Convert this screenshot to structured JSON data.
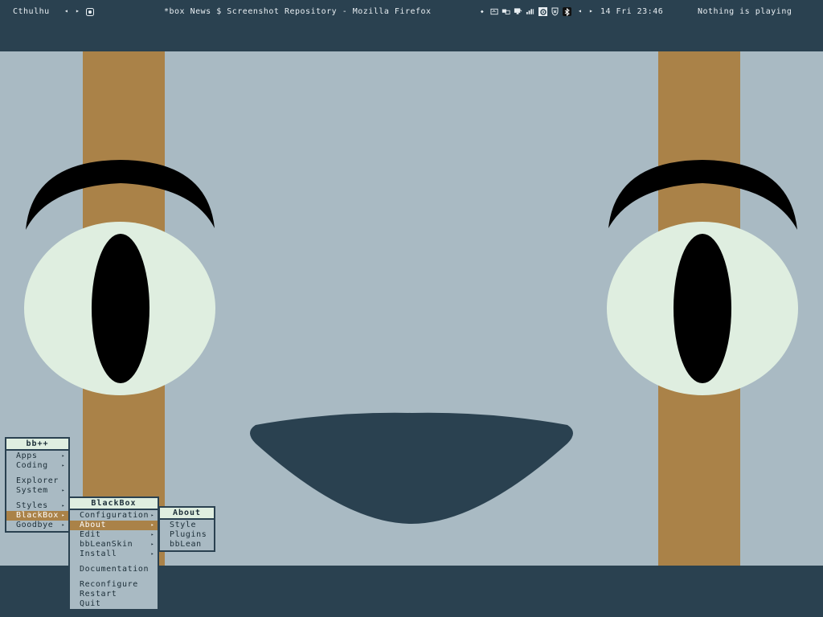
{
  "topbar": {
    "workspace": "Cthulhu",
    "window_title": "*box News $ Screenshot Repository - Mozilla Firefox",
    "clock": "14 Fri 23:46",
    "media": "Nothing is playing",
    "prev_glyph": "◂",
    "next_glyph": "▸",
    "bullet_glyph": "◆",
    "tray_icons": [
      "window-icon",
      "network-icon",
      "monitor-icon",
      "volume-icon",
      "signal-icon",
      "settings-icon",
      "shield-icon",
      "bluetooth-icon"
    ]
  },
  "menus": {
    "main": {
      "title": "bb++",
      "items": [
        {
          "label": "Apps",
          "submenu": "▸"
        },
        {
          "label": "Coding",
          "submenu": "▸"
        },
        {
          "label": "Explorer"
        },
        {
          "label": "System",
          "submenu": "▸"
        },
        {
          "label": "Styles",
          "submenu": "▸"
        },
        {
          "label": "BlackBox",
          "submenu": "▸"
        },
        {
          "label": "Goodbye",
          "submenu": "▸"
        }
      ]
    },
    "blackbox": {
      "title": "BlackBox",
      "items": [
        {
          "label": "Configuration",
          "submenu": "▸"
        },
        {
          "label": "About",
          "submenu": "▸"
        },
        {
          "label": "Edit",
          "submenu": "▸"
        },
        {
          "label": "bbLeanSkin",
          "submenu": "▸"
        },
        {
          "label": "Install",
          "submenu": "▸"
        },
        {
          "label": "Documentation"
        },
        {
          "label": "Reconfigure"
        },
        {
          "label": "Restart"
        },
        {
          "label": "Quit"
        }
      ]
    },
    "about": {
      "title": "About",
      "items": [
        {
          "label": "Style"
        },
        {
          "label": "Plugins"
        },
        {
          "label": "bbLean"
        }
      ]
    }
  },
  "colors": {
    "bar": "#2a4150",
    "wallpaper_bg": "#a9bac3",
    "stripe": "#aa8248",
    "eye_white": "#dfeee0",
    "menu_title_bg": "#dfeee0",
    "selection": "#aa8248"
  }
}
